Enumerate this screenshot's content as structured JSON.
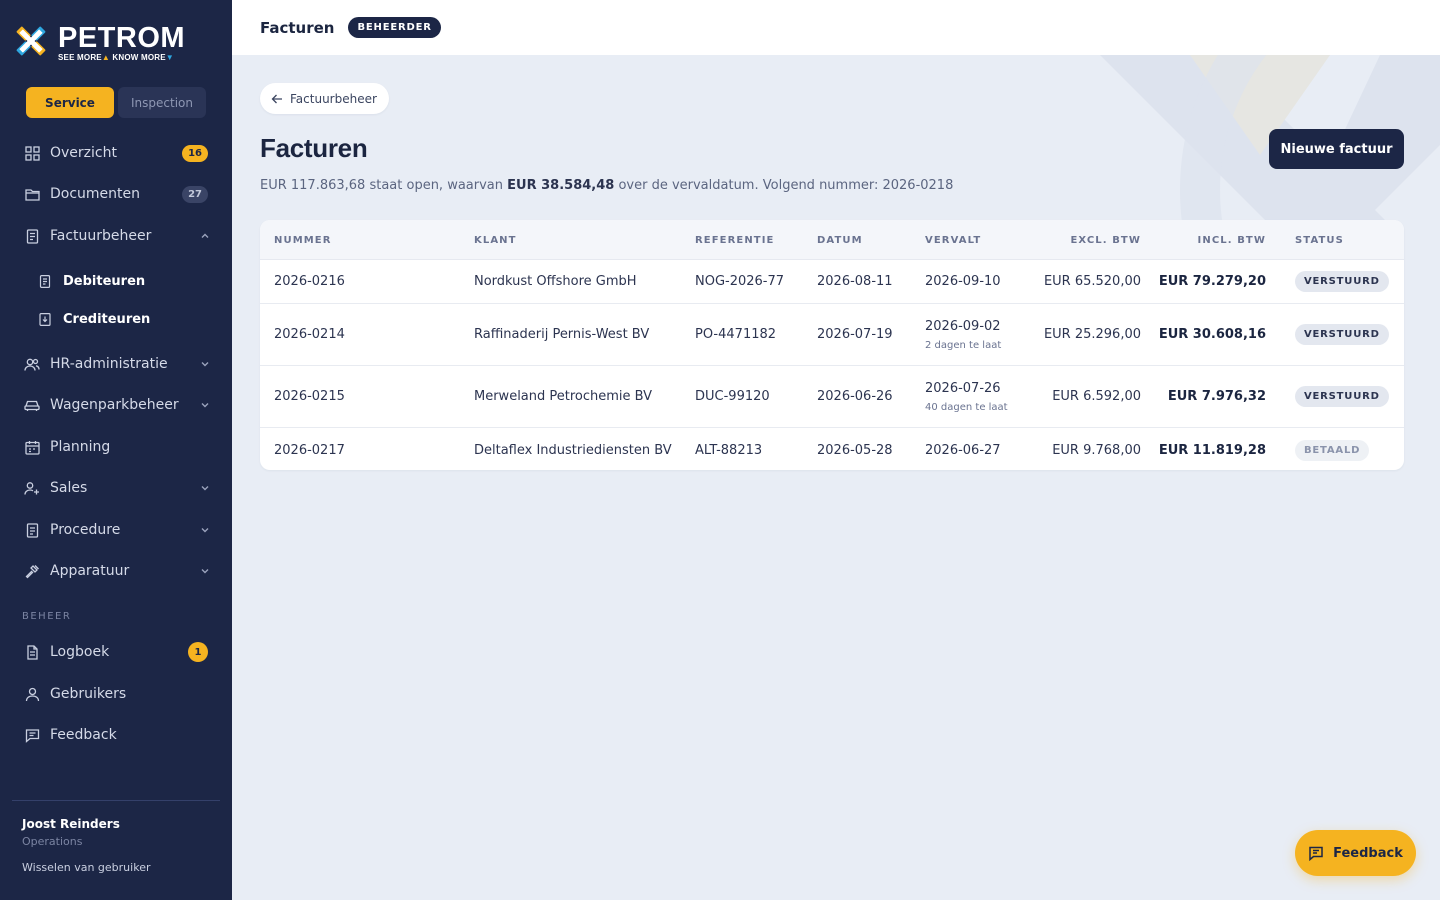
{
  "brand": {
    "name": "PETROM",
    "tagline_left": "SEE MORE",
    "tagline_right": "KNOW MORE"
  },
  "mode_switch": {
    "active": "Service",
    "inactive": "Inspection"
  },
  "sidebar": {
    "items": [
      {
        "label": "Overzicht",
        "badge": "16",
        "icon": "grid-icon"
      },
      {
        "label": "Documenten",
        "badge": "27",
        "icon": "folder-icon"
      },
      {
        "label": "Factuurbeheer",
        "icon": "invoice-icon",
        "expanded": true,
        "children": [
          {
            "label": "Debiteuren",
            "icon": "document-icon"
          },
          {
            "label": "Crediteuren",
            "icon": "document-download-icon"
          }
        ]
      },
      {
        "label": "HR-administratie",
        "icon": "users-icon"
      },
      {
        "label": "Wagenparkbeheer",
        "icon": "car-icon"
      },
      {
        "label": "Planning",
        "icon": "calendar-icon"
      },
      {
        "label": "Sales",
        "icon": "user-plus-icon"
      },
      {
        "label": "Procedure",
        "icon": "clipboard-icon"
      },
      {
        "label": "Apparatuur",
        "icon": "hammer-icon"
      }
    ],
    "section_label": "BEHEER",
    "admin_items": [
      {
        "label": "Logboek",
        "badge": "1",
        "icon": "logbook-icon"
      },
      {
        "label": "Gebruikers",
        "icon": "user-icon"
      },
      {
        "label": "Feedback",
        "icon": "chat-icon"
      }
    ],
    "user": {
      "name": "Joost Reinders",
      "role": "Operations",
      "switch_label": "Wisselen van gebruiker"
    }
  },
  "topbar": {
    "title": "Facturen",
    "role_badge": "BEHEERDER"
  },
  "main": {
    "back_label": "Factuurbeheer",
    "title": "Facturen",
    "summary": {
      "prefix": "EUR 117.863,68 staat open, waarvan ",
      "overdue": "EUR 38.584,48",
      "suffix": " over de vervaldatum. Volgend nummer: 2026-0218"
    },
    "new_button": "Nieuwe factuur",
    "columns": [
      "NUMMER",
      "KLANT",
      "REFERENTIE",
      "DATUM",
      "VERVALT",
      "EXCL. BTW",
      "INCL. BTW",
      "STATUS"
    ],
    "rows": [
      {
        "nummer": "2026-0216",
        "klant": "Nordkust Offshore GmbH",
        "referentie": "NOG-2026-77",
        "datum": "2026-08-11",
        "vervalt": "2026-09-10",
        "late": "",
        "excl": "EUR 65.520,00",
        "incl": "EUR 79.279,20",
        "status": "VERSTUURD"
      },
      {
        "nummer": "2026-0214",
        "klant": "Raffinaderij Pernis-West BV",
        "referentie": "PO-4471182",
        "datum": "2026-07-19",
        "vervalt": "2026-09-02",
        "late": "2 dagen te laat",
        "excl": "EUR 25.296,00",
        "incl": "EUR 30.608,16",
        "status": "VERSTUURD"
      },
      {
        "nummer": "2026-0215",
        "klant": "Merweland Petrochemie BV",
        "referentie": "DUC-99120",
        "datum": "2026-06-26",
        "vervalt": "2026-07-26",
        "late": "40 dagen te laat",
        "excl": "EUR 6.592,00",
        "incl": "EUR 7.976,32",
        "status": "VERSTUURD"
      },
      {
        "nummer": "2026-0217",
        "klant": "Deltaflex Industriediensten BV",
        "referentie": "ALT-88213",
        "datum": "2026-05-28",
        "vervalt": "2026-06-27",
        "late": "",
        "excl": "EUR 9.768,00",
        "incl": "EUR 11.819,28",
        "status": "BETAALD"
      }
    ],
    "feedback_button": "Feedback"
  },
  "colors": {
    "sidebar": "#1c2646",
    "accent": "#f5b320",
    "page_bg": "#e8edf5"
  }
}
